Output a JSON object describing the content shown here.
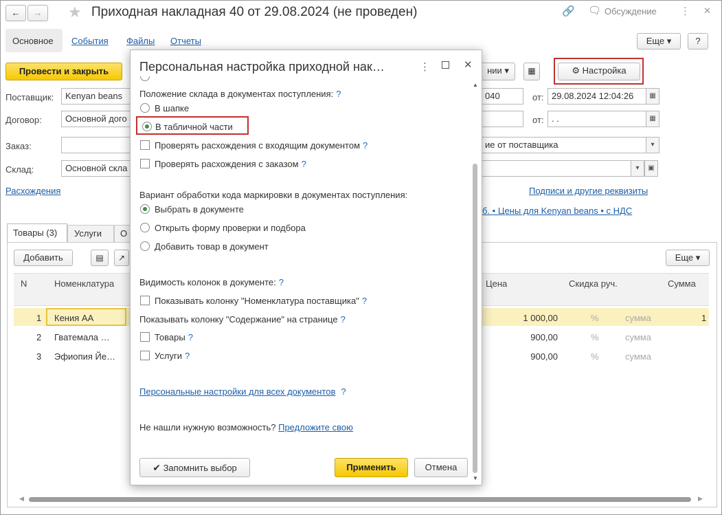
{
  "window": {
    "title": "Приходная накладная 40 от 29.08.2024 (не проведен)",
    "discussion_label": "Обсуждение"
  },
  "tabs": [
    "Основное",
    "События",
    "Файлы",
    "Отчеты"
  ],
  "toolbar": {
    "more_label": "Еще",
    "help_label": "?",
    "post_close_label": "Провести и закрыть",
    "based_on_fragment": "нии",
    "settings_label": "Настройка"
  },
  "form": {
    "supplier_label": "Поставщик:",
    "supplier_value": "Kenyan beans",
    "contract_label": "Договор:",
    "contract_value": "Основной дого",
    "order_label": "Заказ:",
    "order_value": "",
    "warehouse_label": "Склад:",
    "warehouse_value": "Основной скла",
    "number_value": "040",
    "from_label": "от:",
    "date_value": "29.08.2024 12:04:26",
    "date2_value": " .  .",
    "receipt_value": "ие от поставщика",
    "discrepancies_link": "Расхождения",
    "signatures_link": "Подписи и другие реквизиты",
    "prices_link": "б. • Цены для Kenyan beans • с НДС"
  },
  "doc_tabs": [
    "Товары (3)",
    "Услуги",
    "О"
  ],
  "table": {
    "add_label": "Добавить",
    "more_label": "Еще",
    "columns": [
      "N",
      "Номенклатура",
      "Цена",
      "Скидка руч.",
      "Сумма"
    ],
    "rows": [
      {
        "n": "1",
        "name": "Кения АА",
        "price": "1 000,00",
        "pct": "%",
        "sum_hint": "сумма",
        "sum": "1"
      },
      {
        "n": "2",
        "name": "Гватемала …",
        "price": "900,00",
        "pct": "%",
        "sum_hint": "сумма",
        "sum": ""
      },
      {
        "n": "3",
        "name": "Эфиопия Йе…",
        "price": "900,00",
        "pct": "%",
        "sum_hint": "сумма",
        "sum": ""
      }
    ]
  },
  "dialog": {
    "title": "Персональная настройка приходной нак…",
    "q": "?",
    "warehouse_pos_label": "Положение склада в документах поступления:",
    "warehouse_opts": [
      "В шапке",
      "В табличной части"
    ],
    "check_discrepancy_incoming": "Проверять расхождения с входящим документом",
    "check_discrepancy_order": "Проверять расхождения с заказом",
    "marking_label": "Вариант обработки кода маркировки в документах поступления:",
    "marking_opts": [
      "Выбрать в документе",
      "Открыть форму проверки и подбора",
      "Добавить товар в документ"
    ],
    "columns_label": "Видимость колонок в документе:",
    "show_supplier_nomenclature": "Показывать колонку \"Номенклатура поставщика\"",
    "show_content_label": "Показывать колонку \"Содержание\" на странице",
    "content_goods": "Товары",
    "content_services": "Услуги",
    "all_docs_link": "Персональные настройки для всех документов",
    "not_found_text": "Не нашли нужную возможность?",
    "suggest_link": "Предложите свою",
    "remember_label": "Запомнить выбор",
    "apply_label": "Применить",
    "cancel_label": "Отмена"
  },
  "colors": {
    "accent_yellow": "#f6c900",
    "highlight_red": "#c0312d",
    "link_blue": "#1d5ea8",
    "row_selected": "#fbf1bf"
  }
}
